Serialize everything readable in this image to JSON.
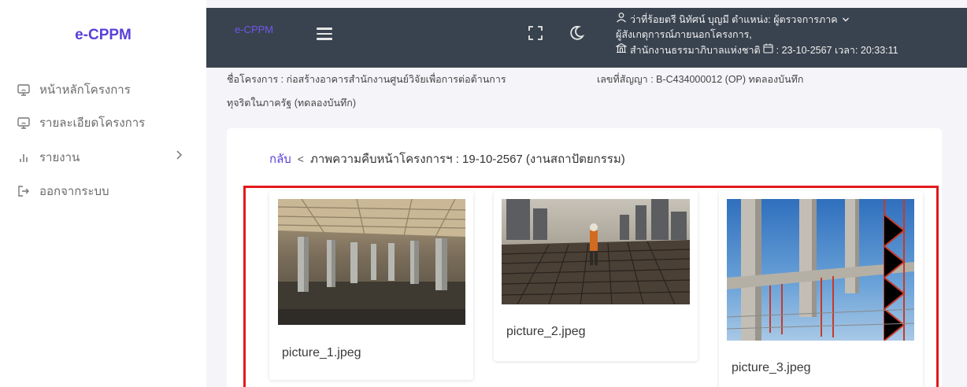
{
  "sidebar": {
    "brand": "e-CPPM",
    "items": [
      {
        "label": "หน้าหลักโครงการ",
        "icon": "monitor-icon"
      },
      {
        "label": "รายละเอียดโครงการ",
        "icon": "monitor-icon"
      },
      {
        "label": "รายงาน",
        "icon": "bar-chart-icon",
        "has_submenu": true
      },
      {
        "label": "ออกจากระบบ",
        "icon": "logout-icon"
      }
    ]
  },
  "topbar": {
    "brand": "e-CPPM",
    "user_line1": "ว่าที่ร้อยตรี นิทัศน์ บุญมี ตำแหน่ง: ผู้ตรวจการภาค",
    "user_line2": "ผู้สังเกตุการณ์ภายนอกโครงการ,",
    "org_line": "สำนักงานธรรมาภิบาลแห่งชาติ",
    "date_line": ": 23-10-2567 เวลา: 20:33:11"
  },
  "project": {
    "name_line1": "ชื่อโครงการ : ก่อสร้างอาคารสำนักงานศูนย์วิจัยเพื่อการต่อต้านการ",
    "name_line2": "ทุจริตในภาครัฐ (ทดลองบันทึก)",
    "contract": "เลขที่สัญญา : B-C434000012 (OP) ทดลองบันทึก"
  },
  "breadcrumb": {
    "back": "กลับ",
    "sep": "<",
    "title": "ภาพความคืบหน้าโครงการฯ : 19-10-2567 (งานสถาปัตยกรรม)"
  },
  "photos": [
    {
      "caption": "picture_1.jpeg"
    },
    {
      "caption": "picture_2.jpeg"
    },
    {
      "caption": "picture_3.jpeg"
    }
  ],
  "colors": {
    "accent": "#5a3fd8",
    "topbar": "#39434f",
    "highlight_box": "#e4191b"
  }
}
